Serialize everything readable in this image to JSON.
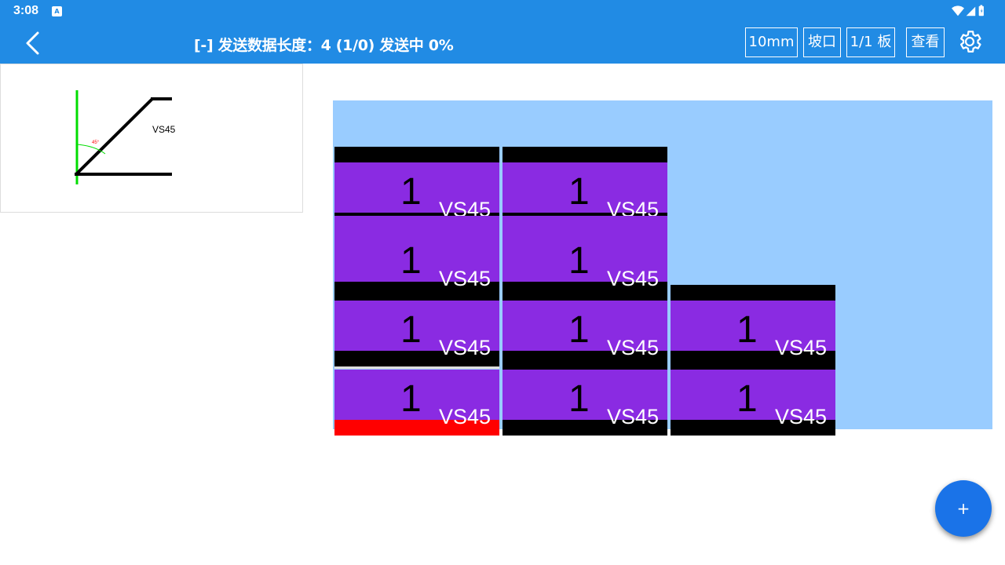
{
  "status_bar": {
    "time": "3:08",
    "notif_icon": "A"
  },
  "app_bar": {
    "title": "[-] 发送数据长度：4 (1/0) 发送中 0%",
    "buttons": {
      "size": "10mm",
      "bevel": "坡口",
      "board": "1/1 板",
      "view": "查看"
    }
  },
  "preview": {
    "label": "VS45",
    "angle_label": "45°"
  },
  "board": {
    "cells": [
      {
        "qty": "1",
        "code": "VS45"
      },
      {
        "qty": "1",
        "code": "VS45"
      },
      {
        "qty": "1",
        "code": "VS45"
      },
      {
        "qty": "1",
        "code": "VS45"
      },
      {
        "qty": "1",
        "code": "VS45"
      },
      {
        "qty": "1",
        "code": "VS45"
      },
      {
        "qty": "1",
        "code": "VS45"
      },
      {
        "qty": "1",
        "code": "VS45"
      },
      {
        "qty": "1",
        "code": "VS45"
      },
      {
        "qty": "1",
        "code": "VS45"
      }
    ]
  },
  "fab": {
    "label": "+"
  },
  "colors": {
    "primary": "#218be4",
    "board_bg": "#99ccff",
    "cell_fill": "#8a2be2",
    "cell_bar": "#000000",
    "selected_bar": "#ff0000",
    "fab": "#1a73e8"
  },
  "icons": [
    "wifi-icon",
    "signal-icon",
    "battery-icon",
    "back-arrow-icon",
    "gear-icon",
    "plus-icon"
  ]
}
